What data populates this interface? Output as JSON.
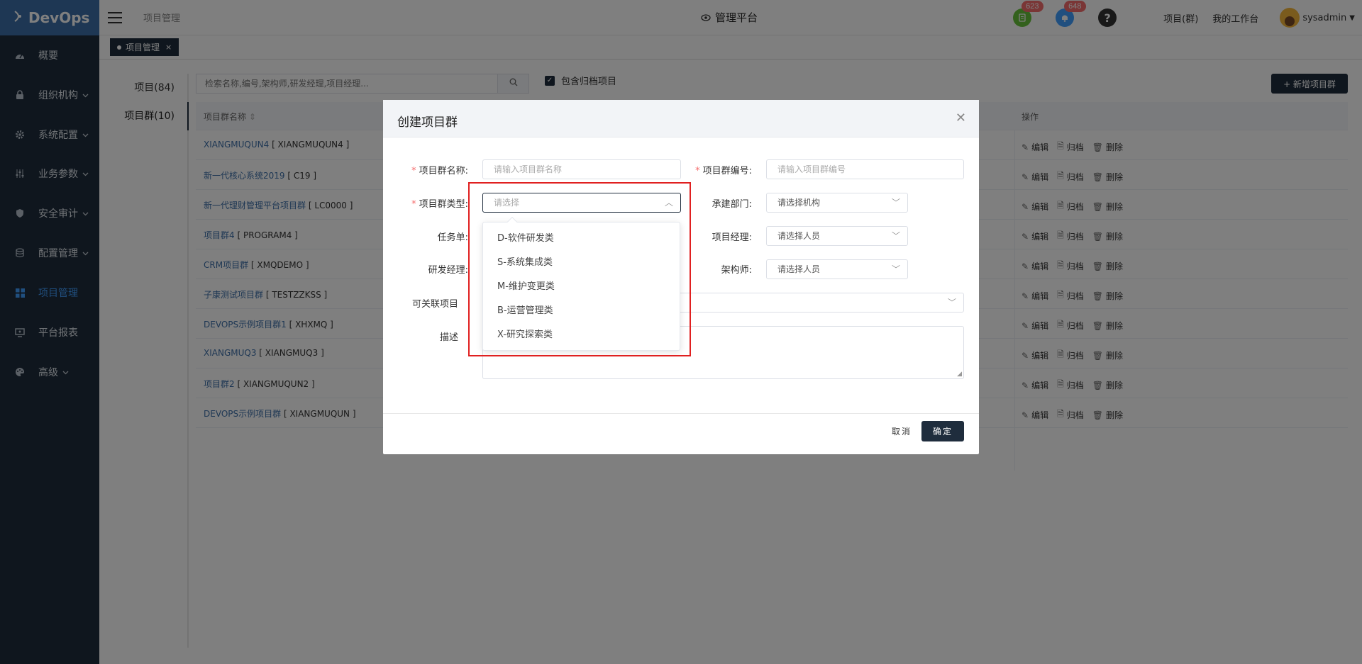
{
  "brand": {
    "name": "DevOps"
  },
  "sidebar": {
    "items": [
      {
        "label": "概要",
        "icon": "dashboard-icon",
        "chevron": false,
        "active": false
      },
      {
        "label": "组织机构",
        "icon": "lock-icon",
        "chevron": true,
        "active": false
      },
      {
        "label": "系统配置",
        "icon": "gear-icon",
        "chevron": true,
        "active": false
      },
      {
        "label": "业务参数",
        "icon": "sliders-icon",
        "chevron": true,
        "active": false
      },
      {
        "label": "安全审计",
        "icon": "shield-icon",
        "chevron": true,
        "active": false
      },
      {
        "label": "配置管理",
        "icon": "database-icon",
        "chevron": true,
        "active": false
      },
      {
        "label": "项目管理",
        "icon": "grid-icon",
        "chevron": false,
        "active": true
      },
      {
        "label": "平台报表",
        "icon": "monitor-icon",
        "chevron": false,
        "active": false
      },
      {
        "label": "高级",
        "icon": "palette-icon",
        "chevron": true,
        "active": false
      }
    ]
  },
  "header": {
    "breadcrumb": "项目管理",
    "center_title": "管理平台",
    "notif_green_count": "623",
    "notif_blue_count": "648",
    "link_project_group": "项目(群)",
    "link_workbench": "我的工作台",
    "username": "sysadmin"
  },
  "tabs": [
    {
      "label": "项目管理",
      "close": "×"
    }
  ],
  "main": {
    "leftnav": [
      {
        "label": "项目(84)"
      },
      {
        "label": "项目群(10)"
      }
    ],
    "search_placeholder": "检索名称,编号,架构师,研发经理,项目经理...",
    "archive_label": "包含归档项目",
    "add_button": "+ 新增项目群",
    "table": {
      "col_name": "项目群名称",
      "col_ops": "操作",
      "ops": {
        "edit": "编辑",
        "archive": "归档",
        "delete": "删除"
      },
      "rows": [
        {
          "name": "XIANGMUQUN4",
          "code": "[ XIANGMUQUN4 ]"
        },
        {
          "name": "新一代核心系统2019",
          "code": "[ C19 ]"
        },
        {
          "name": "新一代理财管理平台项目群",
          "code": "[ LC0000 ]"
        },
        {
          "name": "项目群4",
          "code": "[ PROGRAM4 ]"
        },
        {
          "name": "CRM项目群",
          "code": "[ XMQDEMO ]"
        },
        {
          "name": "子康测试项目群",
          "code": "[ TESTZZKSS ]"
        },
        {
          "name": "DEVOPS示例项目群1",
          "code": "[ XHXMQ ]"
        },
        {
          "name": "XIANGMUQ3",
          "code": "[ XIANGMUQ3 ]"
        },
        {
          "name": "项目群2",
          "code": "[ XIANGMUQUN2 ]"
        },
        {
          "name": "DEVOPS示例项目群",
          "code": "[ XIANGMUQUN ]"
        }
      ]
    }
  },
  "modal": {
    "title": "创建项目群",
    "fields": {
      "name_label": "项目群名称:",
      "name_placeholder": "请输入项目群名称",
      "code_label": "项目群编号:",
      "code_placeholder": "请输入项目群编号",
      "type_label": "项目群类型:",
      "type_placeholder": "请选择",
      "dept_label": "承建部门:",
      "dept_placeholder": "请选择机构",
      "task_label": "任务单:",
      "pm_label": "项目经理:",
      "pm_placeholder": "请选择人员",
      "rd_label": "研发经理:",
      "arch_label": "架构师:",
      "arch_placeholder": "请选择人员",
      "linked_label": "可关联项目",
      "desc_label": "描述"
    },
    "type_options": [
      "D-软件研发类",
      "S-系统集成类",
      "M-维护变更类",
      "B-运营管理类",
      "X-研究探索类"
    ],
    "cancel": "取消",
    "ok": "确定"
  },
  "colors": {
    "sidebar_bg": "#1f2d3d",
    "brand_bg": "#3d6fa8",
    "accent": "#409eff",
    "highlight_box": "#e02020"
  }
}
